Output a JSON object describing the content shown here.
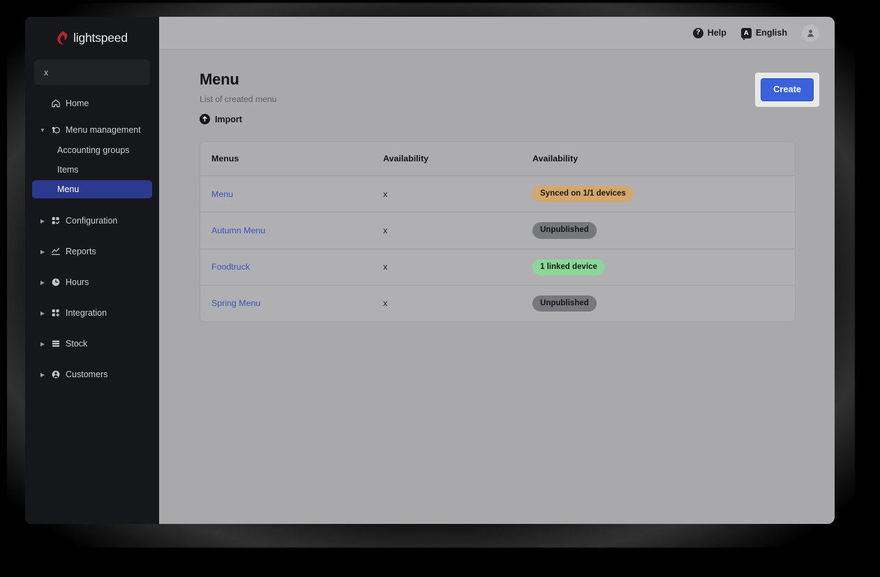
{
  "brand": {
    "name": "lightspeed",
    "logo_icon": "flame-icon"
  },
  "sidebar": {
    "search": {
      "value": "x",
      "placeholder": "x"
    },
    "items": [
      {
        "label": "Home",
        "icon": "home-icon",
        "expandable": false,
        "expanded": false
      },
      {
        "label": "Menu management",
        "icon": "menu-management-icon",
        "expandable": true,
        "expanded": true
      },
      {
        "label": "Configuration",
        "icon": "configuration-icon",
        "expandable": true,
        "expanded": false
      },
      {
        "label": "Reports",
        "icon": "reports-icon",
        "expandable": true,
        "expanded": false
      },
      {
        "label": "Hours",
        "icon": "clock-icon",
        "expandable": true,
        "expanded": false
      },
      {
        "label": "Integration",
        "icon": "integration-icon",
        "expandable": true,
        "expanded": false
      },
      {
        "label": "Stock",
        "icon": "stock-icon",
        "expandable": true,
        "expanded": false
      },
      {
        "label": "Customers",
        "icon": "customers-icon",
        "expandable": true,
        "expanded": false
      }
    ],
    "sub_items": [
      {
        "label": "Accounting groups",
        "active": false
      },
      {
        "label": "Items",
        "active": false
      },
      {
        "label": "Menu",
        "active": true
      }
    ],
    "active_color": "#2b3a8f"
  },
  "topbar": {
    "help_label": "Help",
    "help_icon": "help-circle-icon",
    "help_glyph": "?",
    "language_label": "English",
    "language_icon": "language-icon",
    "language_glyph": "A",
    "avatar_icon": "user-avatar-icon"
  },
  "page": {
    "title": "Menu",
    "subtitle": "List of created menu",
    "import_label": "Import",
    "import_icon": "import-arrow-up-icon",
    "create_label": "Create",
    "create_color": "#3b62dd"
  },
  "table": {
    "columns": [
      "Menus",
      "Availability",
      "Availability"
    ],
    "rows": [
      {
        "name": "Menu",
        "availability": "x",
        "status": "Synced on 1/1 devices",
        "status_type": "synced",
        "status_color": "#d3a86c"
      },
      {
        "name": "Autumn Menu",
        "availability": "x",
        "status": "Unpublished",
        "status_type": "unpublished",
        "status_color": "#76787c"
      },
      {
        "name": "Foodtruck",
        "availability": "x",
        "status": "1 linked device",
        "status_type": "linked",
        "status_color": "#8cd69b"
      },
      {
        "name": "Spring Menu",
        "availability": "x",
        "status": "Unpublished",
        "status_type": "unpublished",
        "status_color": "#76787c"
      }
    ]
  }
}
